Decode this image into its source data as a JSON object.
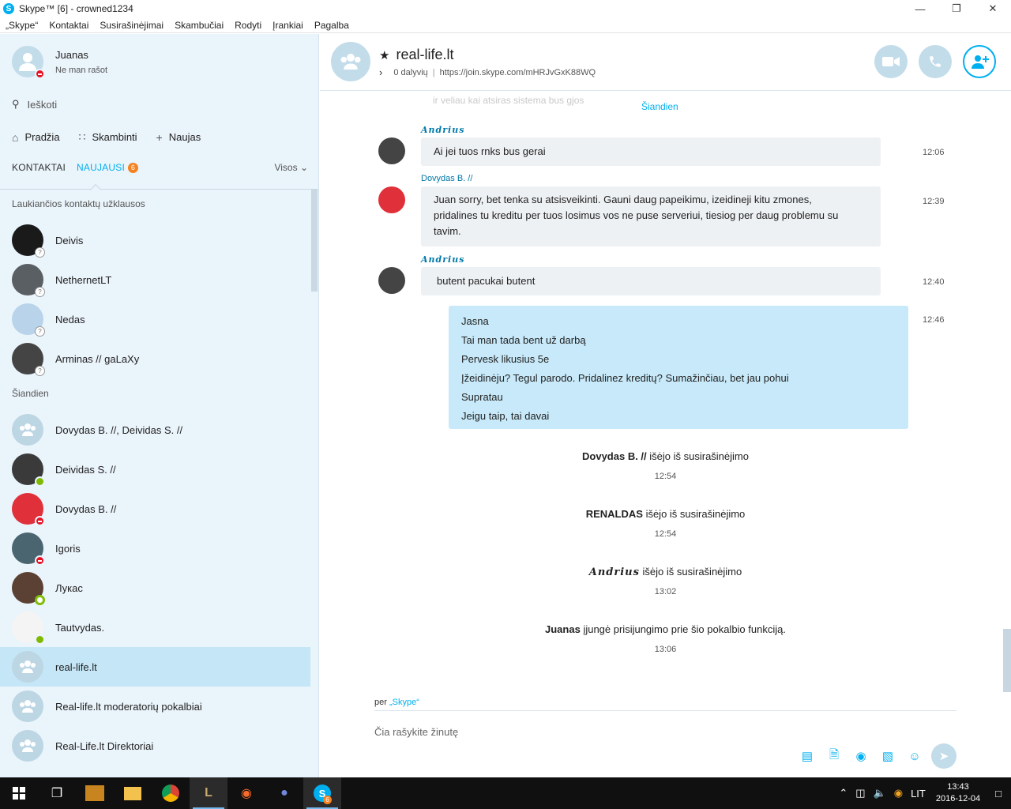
{
  "window": {
    "title": "Skype™ [6] - crowned1234"
  },
  "menu": [
    "„Skype“",
    "Kontaktai",
    "Susirašinėjimai",
    "Skambučiai",
    "Rodyti",
    "Įrankiai",
    "Pagalba"
  ],
  "profile": {
    "name": "Juanas",
    "status": "Ne man rašot"
  },
  "search": {
    "placeholder": "Ieškoti"
  },
  "nav": {
    "home": "Pradžia",
    "call": "Skambinti",
    "new": "Naujas"
  },
  "tabs": {
    "contacts": "KONTAKTAI",
    "recent": "NAUJAUSI",
    "recent_badge": "6",
    "filter": "Visos"
  },
  "sections": {
    "pending": "Laukiančios kontaktų užklausos",
    "today": "Šiandien"
  },
  "pending_contacts": [
    {
      "name": "Deivis"
    },
    {
      "name": "NethernetLT"
    },
    {
      "name": "Nedas"
    },
    {
      "name": "Arminas // gaLaXy"
    }
  ],
  "recent_contacts": [
    {
      "name": "Dovydas B. //, Deividas S. //"
    },
    {
      "name": "Deividas S. //"
    },
    {
      "name": "Dovydas B. //"
    },
    {
      "name": "Igoris"
    },
    {
      "name": "Лукас"
    },
    {
      "name": "Tautvydas."
    },
    {
      "name": "real-life.lt"
    },
    {
      "name": "Real-life.lt moderatorių pokalbiai"
    },
    {
      "name": "Real-Life.lt Direktoriai"
    }
  ],
  "conversation": {
    "title": "real-life.lt",
    "participants": "0 dalyvių",
    "link": "https://join.skype.com/mHRJvGxK88WQ",
    "faded_text": "ir veliau kai atsiras sistema bus gjos",
    "date_divider": "Šiandien",
    "messages": [
      {
        "sender": "Andrius",
        "text": "Ai jei tuos rnks bus gerai",
        "time": "12:06"
      },
      {
        "sender": "Dovydas B. //",
        "line1": "Juan sorry, bet tenka su atsisveikinti. Gauni daug papeikimu, izeidineji kitu zmones,",
        "line2": "pridalines tu kreditu per tuos losimus vos ne puse serveriui, tiesiog per daug problemu su",
        "line3": "tavim.",
        "time": "12:39"
      },
      {
        "sender": "Andrius",
        "text": "butent pacukai butent",
        "time": "12:40"
      }
    ],
    "my_message": {
      "time": "12:46",
      "lines": [
        "Jasna",
        "Tai man tada bent už darbą",
        "Pervesk likusius 5e",
        "Įžeidinėju? Tegul parodo. Pridalinez kreditų? Sumažinčiau, bet jau pohui",
        "Supratau",
        "Jeigu taip, tai davai"
      ]
    },
    "system": [
      {
        "name": "Dovydas B. //",
        "text": " išėjo iš susirašinėjimo",
        "time": "12:54"
      },
      {
        "name": "RENALDAS",
        "text": " išėjo iš susirašinėjimo",
        "time": "12:54"
      },
      {
        "name": "Andrius",
        "text": " išėjo iš susirašinėjimo",
        "time": "13:02"
      },
      {
        "name": "Juanas",
        "text": " įjungė prisijungimo prie šio pokalbio funkciją.",
        "time": "13:06"
      }
    ],
    "via_prefix": "per",
    "via_app": "„Skype“",
    "compose_placeholder": "Čia rašykite žinutę"
  },
  "taskbar": {
    "language": "LIT",
    "time": "13:43",
    "date": "2016-12-04",
    "skype_badge": "6"
  },
  "colors": {
    "accent": "#00aff0",
    "sidebar_bg": "#eaf4fb",
    "my_bubble": "#c7e9f9",
    "busy": "#e81123",
    "online": "#7fba00"
  }
}
